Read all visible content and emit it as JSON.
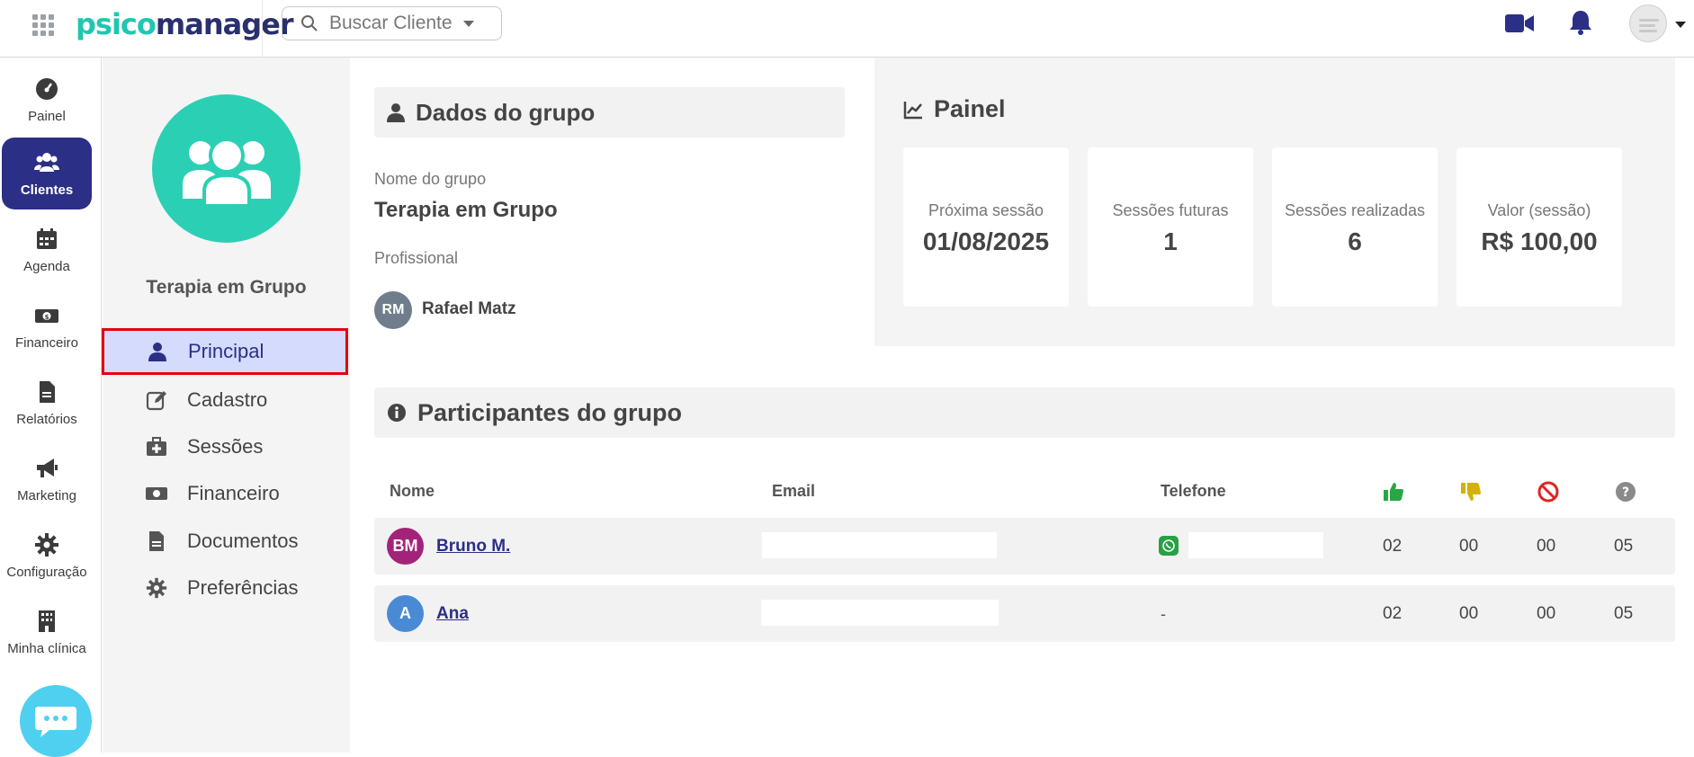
{
  "topbar": {
    "logo_part1": "psico",
    "logo_part2": "manager",
    "search_placeholder": "Buscar Cliente"
  },
  "leftnav": {
    "items": [
      {
        "label": "Painel",
        "icon": "gauge-icon"
      },
      {
        "label": "Clientes",
        "icon": "users-icon",
        "active": true
      },
      {
        "label": "Agenda",
        "icon": "calendar-icon"
      },
      {
        "label": "Financeiro",
        "icon": "money-icon"
      },
      {
        "label": "Relatórios",
        "icon": "document-icon"
      },
      {
        "label": "Marketing",
        "icon": "megaphone-icon"
      },
      {
        "label": "Configuração",
        "icon": "gear-icon"
      },
      {
        "label": "Minha clínica",
        "icon": "building-icon"
      }
    ]
  },
  "group": {
    "name": "Terapia em Grupo",
    "menu": [
      {
        "label": "Principal",
        "icon": "user-icon",
        "active": true
      },
      {
        "label": "Cadastro",
        "icon": "edit-icon"
      },
      {
        "label": "Sessões",
        "icon": "medkit-icon"
      },
      {
        "label": "Financeiro",
        "icon": "money-icon"
      },
      {
        "label": "Documentos",
        "icon": "file-icon"
      },
      {
        "label": "Preferências",
        "icon": "gear-icon"
      }
    ]
  },
  "dados": {
    "title": "Dados do grupo",
    "nome_label": "Nome do grupo",
    "nome_value": "Terapia em Grupo",
    "prof_label": "Profissional",
    "prof_initials": "RM",
    "prof_name": "Rafael Matz"
  },
  "painel": {
    "title": "Painel",
    "cards": [
      {
        "label": "Próxima sessão",
        "value": "01/08/2025"
      },
      {
        "label": "Sessões futuras",
        "value": "1"
      },
      {
        "label": "Sessões realizadas",
        "value": "6"
      },
      {
        "label": "Valor (sessão)",
        "value": "R$ 100,00"
      }
    ]
  },
  "participantes": {
    "title": "Participantes do grupo",
    "headers": {
      "nome": "Nome",
      "email": "Email",
      "telefone": "Telefone"
    },
    "status_icons": [
      "thumbs-up-icon",
      "thumbs-down-icon",
      "ban-icon",
      "question-icon"
    ],
    "colors": {
      "up": "#28a745",
      "down": "#d4b106",
      "ban": "#e02424",
      "question": "#8a8a8a"
    },
    "rows": [
      {
        "initials": "BM",
        "avatar_color": "#a3237a",
        "name": "Bruno M.",
        "phone_dash": "",
        "c1": "02",
        "c2": "00",
        "c3": "00",
        "c4": "05"
      },
      {
        "initials": "A",
        "avatar_color": "#4a8ad4",
        "name": "Ana",
        "phone_dash": "-",
        "c1": "02",
        "c2": "00",
        "c3": "00",
        "c4": "05"
      }
    ]
  }
}
